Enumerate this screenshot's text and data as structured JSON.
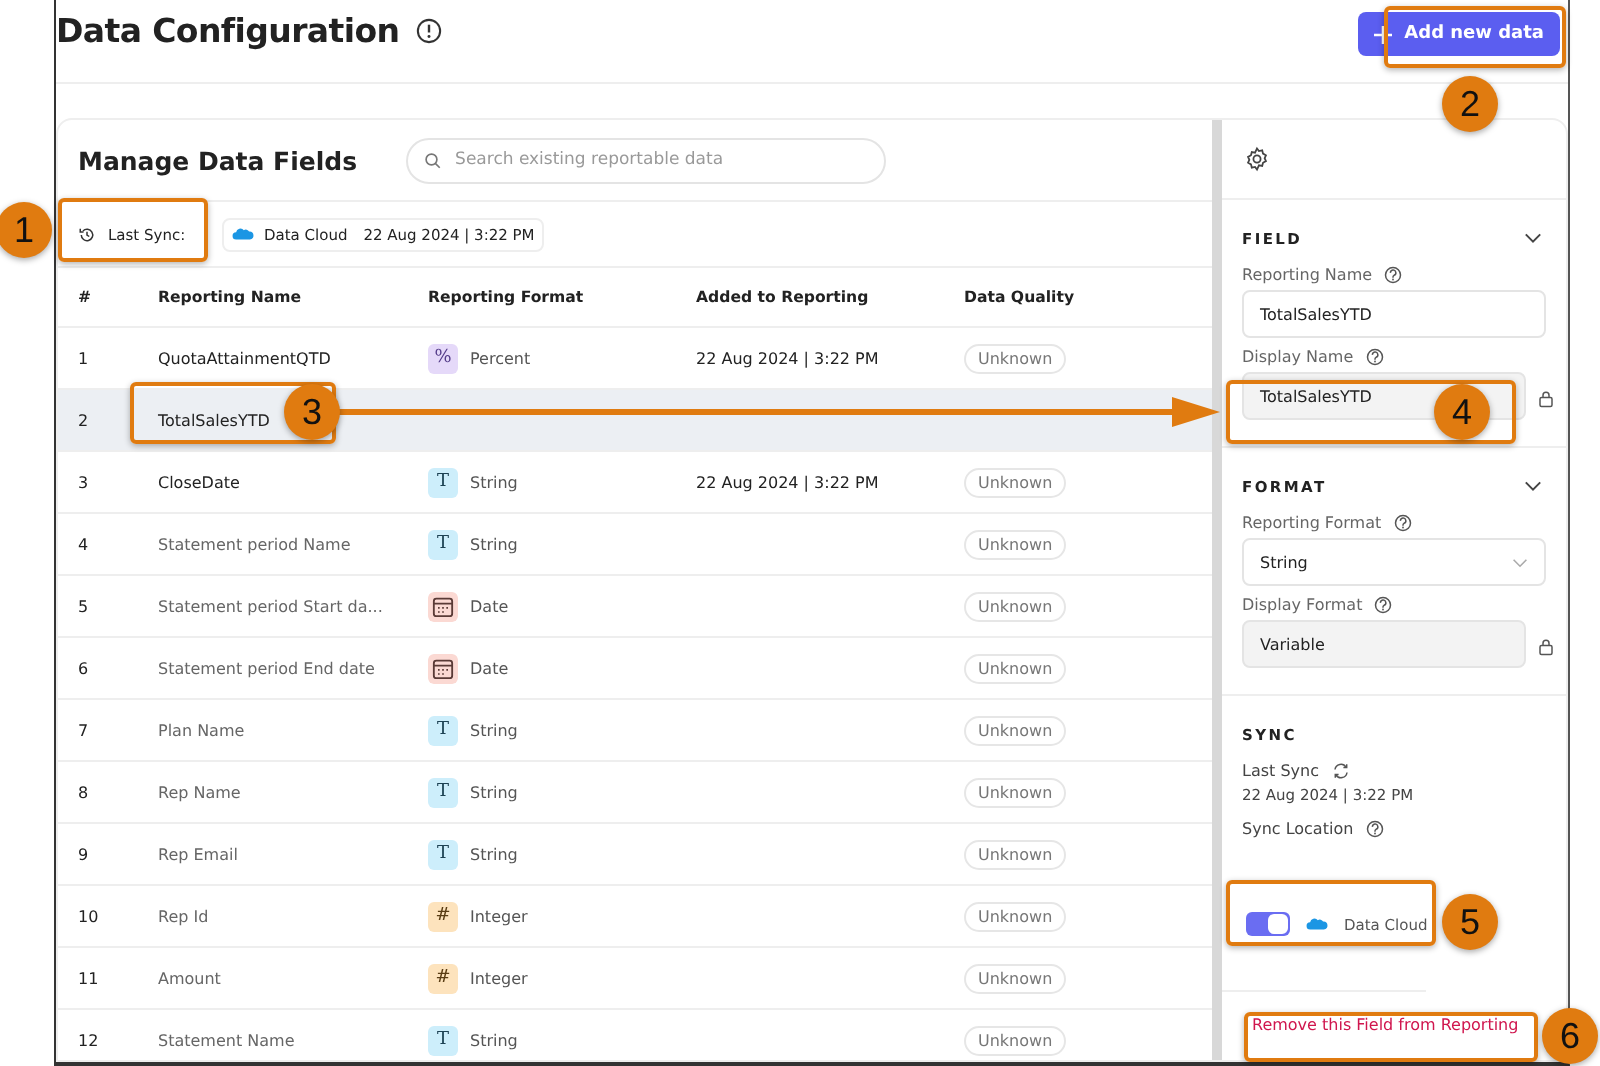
{
  "header": {
    "title": "Data Configuration",
    "add_button": "Add new data"
  },
  "manage": {
    "title": "Manage Data Fields",
    "search": {
      "placeholder": "Search existing reportable data"
    },
    "last_sync_label": "Last Sync:",
    "sync_source": "Data Cloud",
    "sync_time": "22 Aug 2024 | 3:22 PM"
  },
  "table": {
    "columns": [
      "#",
      "Reporting Name",
      "Reporting Format",
      "Added to Reporting",
      "Data Quality"
    ],
    "rows": [
      {
        "num": "1",
        "name": "QuotaAttainmentQTD",
        "kind": "percent",
        "format_icon": "%",
        "format": "Percent",
        "added": "22 Aug 2024 | 3:22 PM",
        "quality": "Unknown",
        "active": true,
        "selected": false
      },
      {
        "num": "2",
        "name": "TotalSalesYTD",
        "active": true,
        "selected": true
      },
      {
        "num": "3",
        "name": "CloseDate",
        "kind": "string",
        "format_icon": "T",
        "format": "String",
        "added": "22 Aug 2024 | 3:22 PM",
        "quality": "Unknown",
        "active": true,
        "selected": false
      },
      {
        "num": "4",
        "name": "Statement period Name",
        "kind": "string",
        "format_icon": "T",
        "format": "String",
        "quality": "Unknown",
        "active": false,
        "selected": false
      },
      {
        "num": "5",
        "name": "Statement period Start da...",
        "kind": "date",
        "format": "Date",
        "quality": "Unknown",
        "active": false,
        "selected": false
      },
      {
        "num": "6",
        "name": "Statement period End date",
        "kind": "date",
        "format": "Date",
        "quality": "Unknown",
        "active": false,
        "selected": false
      },
      {
        "num": "7",
        "name": "Plan Name",
        "kind": "string",
        "format_icon": "T",
        "format": "String",
        "quality": "Unknown",
        "active": false,
        "selected": false
      },
      {
        "num": "8",
        "name": "Rep Name",
        "kind": "string",
        "format_icon": "T",
        "format": "String",
        "quality": "Unknown",
        "active": false,
        "selected": false
      },
      {
        "num": "9",
        "name": "Rep Email",
        "kind": "string",
        "format_icon": "T",
        "format": "String",
        "quality": "Unknown",
        "active": false,
        "selected": false
      },
      {
        "num": "10",
        "name": "Rep Id",
        "kind": "integer",
        "format_icon": "#",
        "format": "Integer",
        "quality": "Unknown",
        "active": false,
        "selected": false
      },
      {
        "num": "11",
        "name": "Amount",
        "kind": "integer",
        "format_icon": "#",
        "format": "Integer",
        "quality": "Unknown",
        "active": false,
        "selected": false
      },
      {
        "num": "12",
        "name": "Statement Name",
        "kind": "string",
        "format_icon": "T",
        "format": "String",
        "quality": "Unknown",
        "active": false,
        "selected": false
      }
    ]
  },
  "side": {
    "field": {
      "title": "FIELD",
      "reporting_name_label": "Reporting Name",
      "reporting_name": "TotalSalesYTD",
      "display_name_label": "Display Name",
      "display_name": "TotalSalesYTD"
    },
    "format": {
      "title": "FORMAT",
      "reporting_format_label": "Reporting Format",
      "reporting_format": "String",
      "display_format_label": "Display Format",
      "display_format": "Variable"
    },
    "sync": {
      "title": "SYNC",
      "last_sync_label": "Last Sync",
      "last_sync": "22 Aug 2024 | 3:22 PM",
      "location_label": "Sync Location",
      "toggle_on": true,
      "destination": "Data Cloud"
    },
    "remove_link": "Remove this Field from Reporting"
  },
  "callouts": [
    "1",
    "2",
    "3",
    "4",
    "5",
    "6"
  ]
}
